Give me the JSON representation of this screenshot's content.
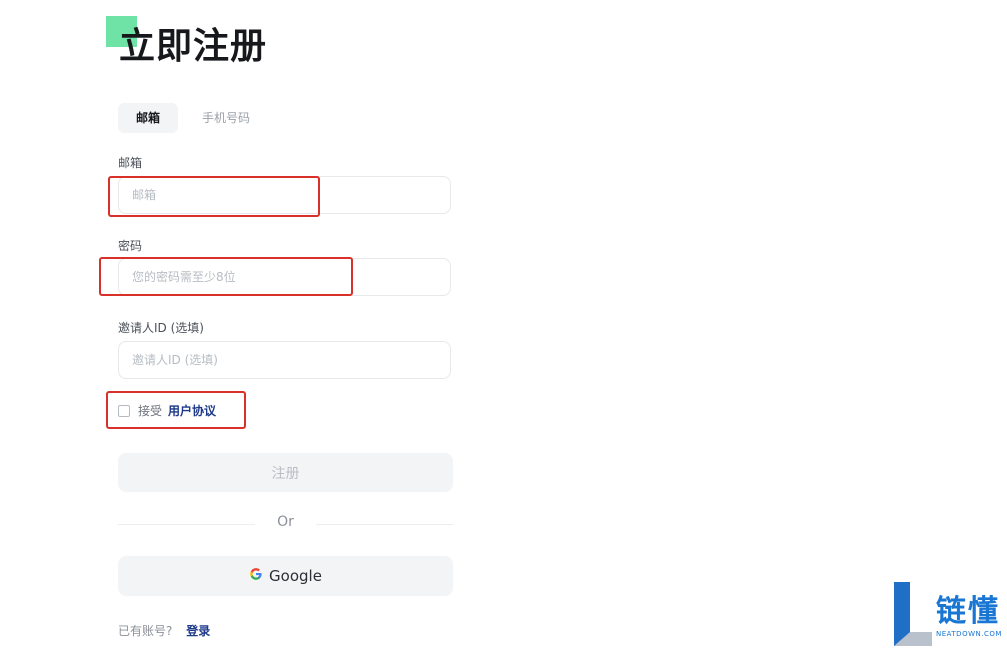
{
  "page": {
    "title": "立即注册"
  },
  "tabs": [
    {
      "label": "邮箱",
      "active": true
    },
    {
      "label": "手机号码",
      "active": false
    }
  ],
  "form": {
    "email_label": "邮箱",
    "email_placeholder": "邮箱",
    "email_value": "",
    "password_label": "密码",
    "password_placeholder": "您的密码需至少8位",
    "password_value": "",
    "invite_label": "邀请人ID (选填)",
    "invite_placeholder": "邀请人ID (选填)",
    "invite_value": "",
    "agree_text": "接受",
    "agree_link": "用户协议",
    "agree_checked": false,
    "register_label": "注册",
    "divider_text": "Or",
    "google_label": "Google"
  },
  "footer": {
    "text": "已有账号?",
    "login_label": "登录"
  },
  "watermark": {
    "logo_text": "链懂",
    "sub_text": "NEATDOWN.COM"
  },
  "colors": {
    "accent": "#6fe3a6",
    "highlight": "#d9302a",
    "link": "#1d3a8a"
  },
  "icons": {
    "google": "google-g-icon",
    "watermark_logo": "neatdown-logo-icon"
  }
}
